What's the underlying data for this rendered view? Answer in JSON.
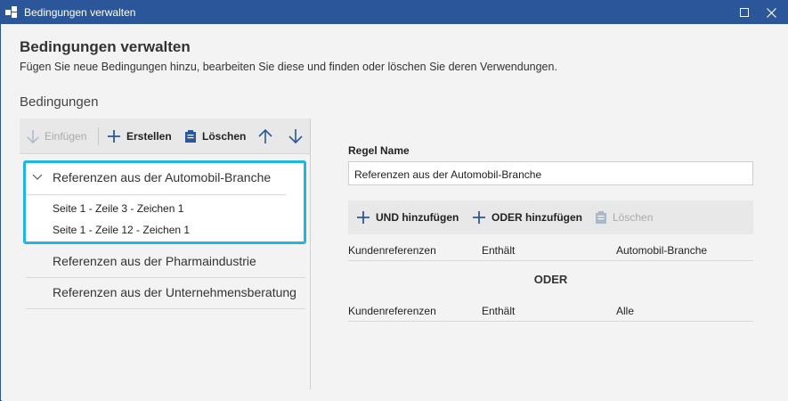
{
  "window": {
    "title": "Bedingungen verwalten",
    "maximize_glyph": "☐",
    "close_glyph": "✕"
  },
  "header": {
    "title": "Bedingungen verwalten",
    "description": "Fügen Sie neue Bedingungen hinzu, bearbeiten Sie diese und finden oder löschen Sie deren Verwendungen."
  },
  "conditions_section": {
    "label": "Bedingungen",
    "toolbar": {
      "insert_label": "Einfügen",
      "create_label": "Erstellen",
      "delete_label": "Löschen"
    },
    "items": [
      {
        "label": "Referenzen aus der Automobil-Branche",
        "expanded": true,
        "selected": true,
        "children": [
          "Seite 1 - Zeile 3 - Zeichen 1",
          "Seite 1 - Zeile 12 - Zeichen 1"
        ]
      },
      {
        "label": "Referenzen aus der Pharmaindustrie"
      },
      {
        "label": "Referenzen aus der Unternehmensberatung"
      }
    ]
  },
  "rule_editor": {
    "name_label": "Regel Name",
    "name_value": "Referenzen aus der Automobil-Branche",
    "toolbar": {
      "add_and_label": "UND hinzufügen",
      "add_or_label": "ODER hinzufügen",
      "delete_label": "Löschen"
    },
    "conditions": [
      {
        "field": "Kundenreferenzen",
        "operator": "Enthält",
        "value": "Automobil-Branche"
      },
      {
        "field": "Kundenreferenzen",
        "operator": "Enthält",
        "value": "Alle"
      }
    ],
    "connector_label": "ODER"
  },
  "colors": {
    "titlebar": "#2b579a",
    "selection_border": "#1fb6e0",
    "icon_blue": "#2b579a"
  }
}
